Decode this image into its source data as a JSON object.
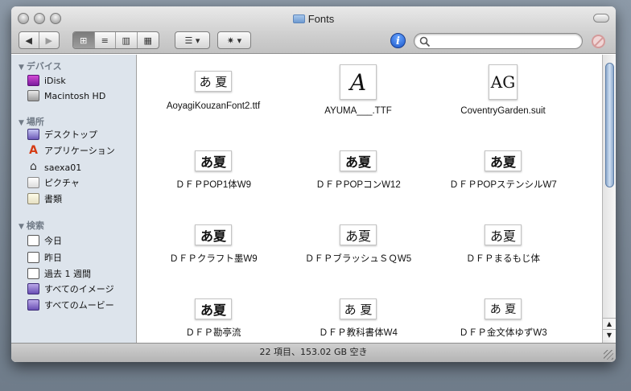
{
  "window": {
    "title": "Fonts",
    "status": "22 項目、153.02 GB 空き"
  },
  "toolbar": {
    "back_glyph": "◀",
    "forward_glyph": "▶",
    "view_glyphs": [
      "⊞",
      "≡",
      "▥",
      "▦"
    ],
    "arrange_glyph": "☰ ▾",
    "action_glyph": "✷ ▾",
    "info_glyph": "i",
    "search_placeholder": ""
  },
  "sidebar": {
    "sections": [
      {
        "label": "デバイス",
        "items": [
          {
            "label": "iDisk",
            "icon": "idisk-icon"
          },
          {
            "label": "Macintosh HD",
            "icon": "hard-drive-icon"
          }
        ]
      },
      {
        "label": "場所",
        "items": [
          {
            "label": "デスクトップ",
            "icon": "desktop-icon"
          },
          {
            "label": "アプリケーション",
            "icon": "applications-icon"
          },
          {
            "label": "saexa01",
            "icon": "home-icon"
          },
          {
            "label": "ピクチャ",
            "icon": "pictures-icon"
          },
          {
            "label": "書類",
            "icon": "documents-icon"
          }
        ]
      },
      {
        "label": "検索",
        "items": [
          {
            "label": "今日",
            "icon": "clock-icon"
          },
          {
            "label": "昨日",
            "icon": "clock-icon"
          },
          {
            "label": "過去 1 週間",
            "icon": "clock-icon"
          },
          {
            "label": "すべてのイメージ",
            "icon": "smart-folder-icon"
          },
          {
            "label": "すべてのムービー",
            "icon": "smart-folder-icon"
          }
        ]
      }
    ]
  },
  "files": [
    {
      "name": "AoyagiKouzanFont2.ttf",
      "preview": "あ 夏"
    },
    {
      "name": "AYUMA___.TTF",
      "preview": "A"
    },
    {
      "name": "CoventryGarden.suit",
      "preview": "AG"
    },
    {
      "name": "ＤＦＰPOP1体W9",
      "preview": "あ夏"
    },
    {
      "name": "ＤＦＰPOPコンW12",
      "preview": "あ夏"
    },
    {
      "name": "ＤＦＰPOPステンシルW7",
      "preview": "あ夏"
    },
    {
      "name": "ＤＦＰクラフト墨W9",
      "preview": "あ夏"
    },
    {
      "name": "ＤＦＰブラッシュＳＱW5",
      "preview": "あ夏"
    },
    {
      "name": "ＤＦＰまるもじ体",
      "preview": "あ夏"
    },
    {
      "name": "ＤＦＰ勘亭流",
      "preview": "あ夏"
    },
    {
      "name": "ＤＦＰ教科書体W4",
      "preview": "あ 夏"
    },
    {
      "name": "ＤＦＰ金文体ゆずW3",
      "preview": "あ 夏"
    }
  ],
  "colors": {
    "sidebar_bg": "#dde4ec",
    "section_header": "#707a86",
    "scroll_thumb": "#8aa7cb"
  }
}
